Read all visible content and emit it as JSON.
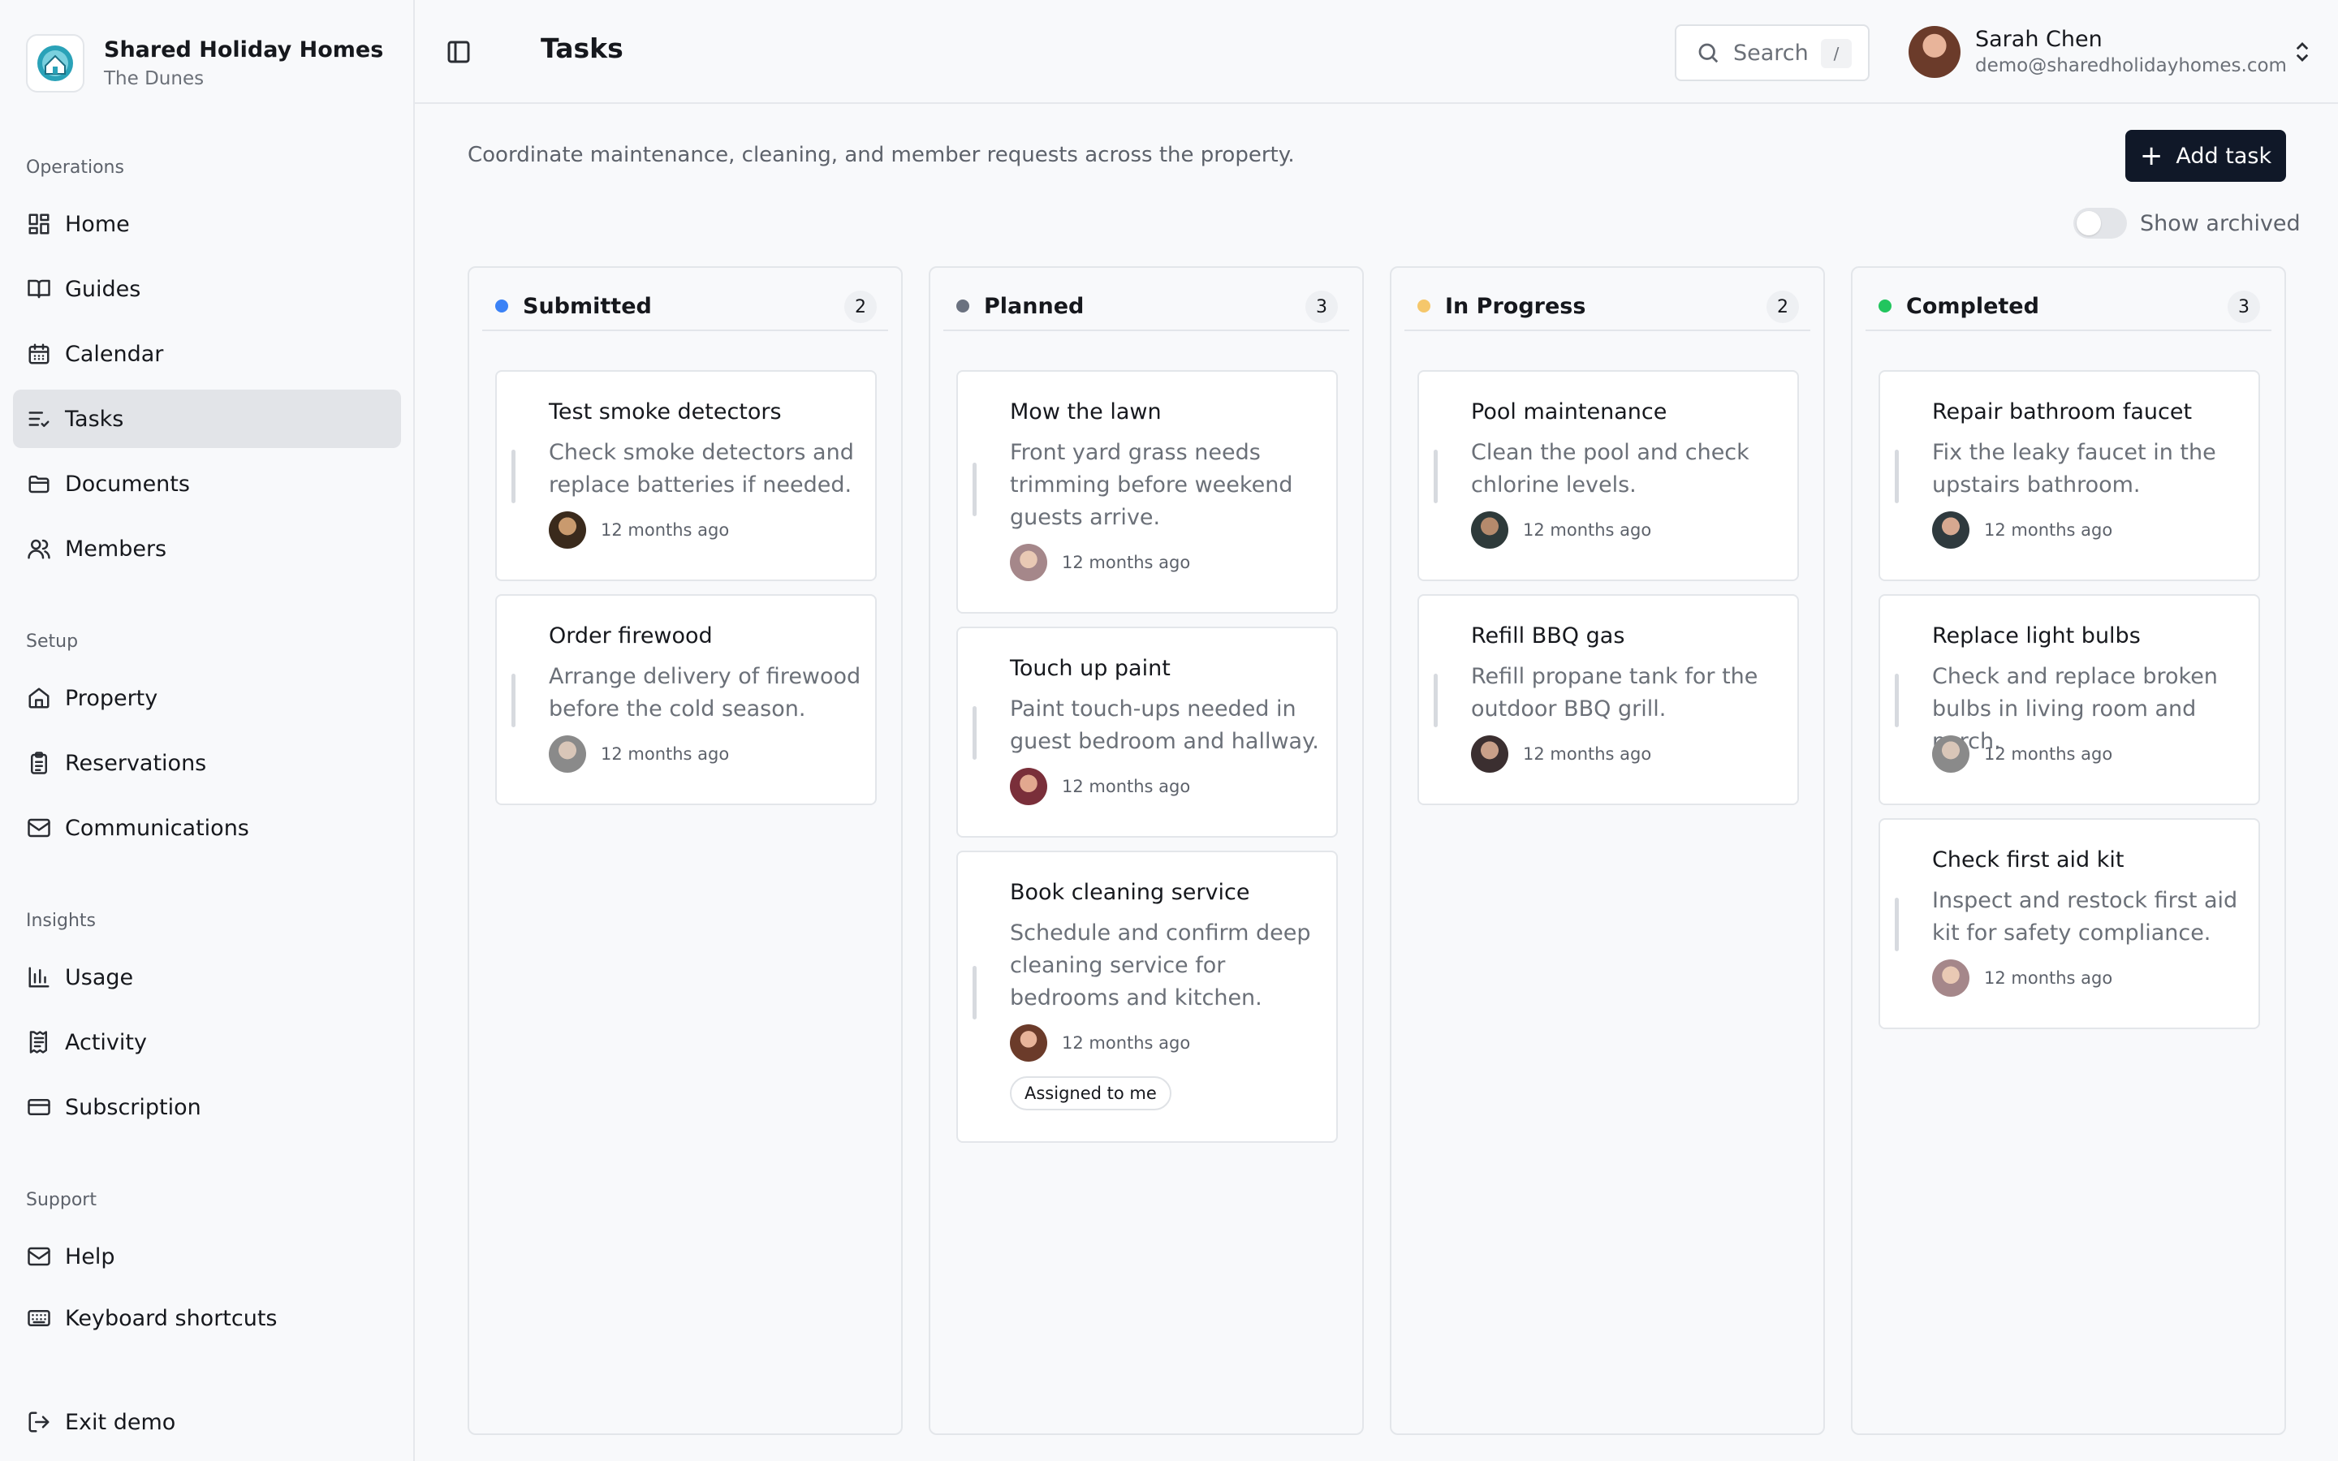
{
  "sidebar": {
    "brand_name": "Shared Holiday Homes",
    "brand_sub": "The Dunes",
    "sections": [
      "Operations",
      "Setup",
      "Insights",
      "Support"
    ],
    "items": [
      {
        "label": "Home",
        "icon": "grid-icon"
      },
      {
        "label": "Guides",
        "icon": "book-icon"
      },
      {
        "label": "Calendar",
        "icon": "calendar-icon"
      },
      {
        "label": "Tasks",
        "icon": "list-check-icon",
        "active": true
      },
      {
        "label": "Documents",
        "icon": "folder-icon"
      },
      {
        "label": "Members",
        "icon": "users-icon"
      },
      {
        "label": "Property",
        "icon": "house-icon"
      },
      {
        "label": "Reservations",
        "icon": "clipboard-icon"
      },
      {
        "label": "Communications",
        "icon": "mail-icon"
      },
      {
        "label": "Usage",
        "icon": "bar-chart-icon"
      },
      {
        "label": "Activity",
        "icon": "receipt-icon"
      },
      {
        "label": "Subscription",
        "icon": "credit-card-icon"
      },
      {
        "label": "Help",
        "icon": "mail-icon"
      },
      {
        "label": "Keyboard shortcuts",
        "icon": "keyboard-icon"
      },
      {
        "label": "Exit demo",
        "icon": "logout-icon"
      }
    ]
  },
  "header": {
    "title": "Tasks",
    "search_label": "Search",
    "search_shortcut": "/",
    "user_name": "Sarah Chen",
    "user_email": "demo@sharedholidayhomes.com"
  },
  "main": {
    "subtitle": "Coordinate maintenance, cleaning, and member requests across the property.",
    "add_task_label": "Add task",
    "show_archived_label": "Show archived",
    "show_archived": false
  },
  "columns": [
    {
      "title": "Submitted",
      "count": "2",
      "color": "#3b82f6",
      "cards": [
        {
          "title": "Test smoke detectors",
          "desc": "Check smoke detectors and replace batteries if needed.",
          "time": "12 months ago"
        },
        {
          "title": "Order firewood",
          "desc": "Arrange delivery of firewood before the cold season.",
          "time": "12 months ago"
        }
      ]
    },
    {
      "title": "Planned",
      "count": "3",
      "color": "#6b7280",
      "cards": [
        {
          "title": "Mow the lawn",
          "desc": "Front yard grass needs trimming before weekend guests arrive.",
          "time": "12 months ago"
        },
        {
          "title": "Touch up paint",
          "desc": "Paint touch-ups needed in guest bedroom and hallway.",
          "time": "12 months ago"
        },
        {
          "title": "Book cleaning service",
          "desc": "Schedule and confirm deep cleaning service for bedrooms and kitchen.",
          "time": "12 months ago",
          "badge": "Assigned to me"
        }
      ]
    },
    {
      "title": "In Progress",
      "count": "2",
      "color": "#f5c76b",
      "cards": [
        {
          "title": "Pool maintenance",
          "desc": "Clean the pool and check chlorine levels.",
          "time": "12 months ago"
        },
        {
          "title": "Refill BBQ gas",
          "desc": "Refill propane tank for the outdoor BBQ grill.",
          "time": "12 months ago"
        }
      ]
    },
    {
      "title": "Completed",
      "count": "3",
      "color": "#22c55e",
      "cards": [
        {
          "title": "Repair bathroom faucet",
          "desc": "Fix the leaky faucet in the upstairs bathroom.",
          "time": "12 months ago"
        },
        {
          "title": "Replace light bulbs",
          "desc": "Check and replace broken bulbs in living room and porch.",
          "time": "12 months ago"
        },
        {
          "title": "Check first aid kit",
          "desc": "Inspect and restock first aid kit for safety compliance.",
          "time": "12 months ago"
        }
      ]
    }
  ]
}
